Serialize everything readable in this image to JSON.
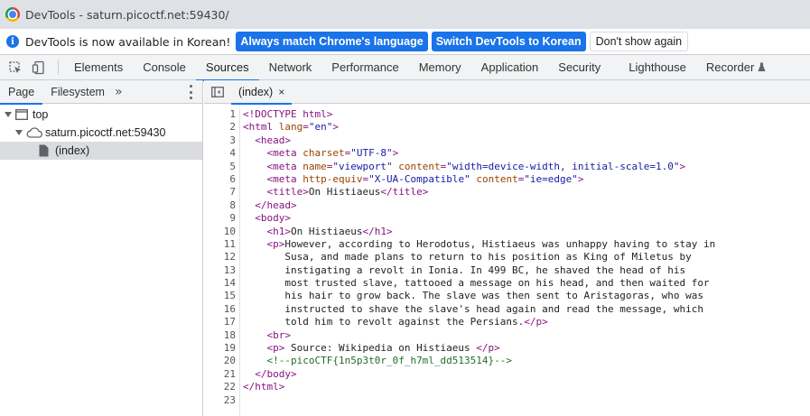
{
  "window": {
    "title": "DevTools - saturn.picoctf.net:59430/"
  },
  "infobar": {
    "message": "DevTools is now available in Korean!",
    "btn_match": "Always match Chrome's language",
    "btn_switch": "Switch DevTools to Korean",
    "btn_dismiss": "Don't show again"
  },
  "tabs": [
    "Elements",
    "Console",
    "Sources",
    "Network",
    "Performance",
    "Memory",
    "Application",
    "Security",
    "Lighthouse",
    "Recorder"
  ],
  "active_tab": "Sources",
  "navigator": {
    "tabs": [
      "Page",
      "Filesystem"
    ],
    "more": "»",
    "tree": [
      {
        "label": "top",
        "depth": 0
      },
      {
        "label": "saturn.picoctf.net:59430",
        "depth": 1
      },
      {
        "label": "(index)",
        "depth": 2
      }
    ]
  },
  "editor": {
    "file_tab": "(index)",
    "close": "×",
    "lines": [
      "<!DOCTYPE html>",
      "<html lang=\"en\">",
      "  <head>",
      "    <meta charset=\"UTF-8\">",
      "    <meta name=\"viewport\" content=\"width=device-width, initial-scale=1.0\">",
      "    <meta http-equiv=\"X-UA-Compatible\" content=\"ie=edge\">",
      "    <title>On Histiaeus</title>",
      "  </head>",
      "  <body>",
      "    <h1>On Histiaeus</h1>",
      "    <p>However, according to Herodotus, Histiaeus was unhappy having to stay in",
      "       Susa, and made plans to return to his position as King of Miletus by",
      "       instigating a revolt in Ionia. In 499 BC, he shaved the head of his",
      "       most trusted slave, tattooed a message on his head, and then waited for",
      "       his hair to grow back. The slave was then sent to Aristagoras, who was",
      "       instructed to shave the slave's head again and read the message, which",
      "       told him to revolt against the Persians.</p>",
      "    <br>",
      "    <p> Source: Wikipedia on Histiaeus </p>",
      "    <!--picoCTF{1n5p3t0r_0f_h7ml_dd513514}-->",
      "  </body>",
      "</html>",
      ""
    ]
  },
  "colors": {
    "accent": "#1a73e8",
    "tag": "#881280",
    "attr": "#994500",
    "value": "#1a1aa6",
    "comment": "#236e25"
  }
}
